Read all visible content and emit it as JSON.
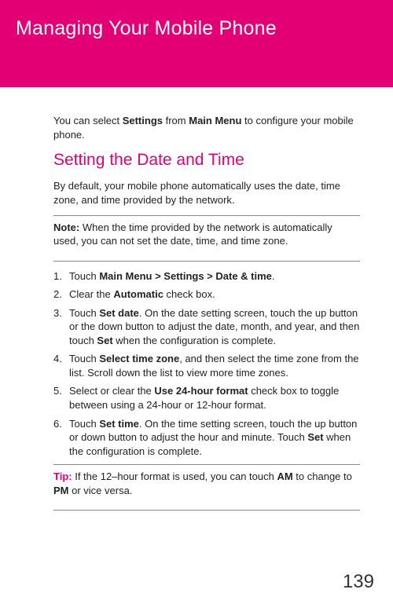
{
  "banner": {
    "title": "Managing Your Mobile Phone"
  },
  "intro": {
    "pre": "You can select ",
    "b1": "Settings",
    "mid": " from ",
    "b2": "Main Menu",
    "post": " to configure your mobile phone."
  },
  "section": {
    "heading": "Setting the Date and Time"
  },
  "default_text": "By default, your mobile phone automatically uses the date, time zone, and time provided by the network.",
  "note": {
    "label": "Note:  ",
    "text": "When the time provided by the network is automatically used, you can not set the date, time, and time zone."
  },
  "steps": {
    "s1": {
      "pre": "Touch ",
      "b": "Main Menu > Settings > Date & time",
      "post": "."
    },
    "s2": {
      "pre": "Clear the ",
      "b": "Automatic",
      "post": " check box."
    },
    "s3": {
      "pre": "Touch ",
      "b1": "Set date",
      "mid": ". On the date setting screen, touch the up button or the down button to adjust the date, month, and year, and then touch ",
      "b2": "Set",
      "post": " when the configuration is complete."
    },
    "s4": {
      "pre": "Touch ",
      "b": "Select time zone",
      "post": ", and then select the time zone from the list. Scroll down the list to view more time zones."
    },
    "s5": {
      "pre": "Select or clear the ",
      "b": "Use 24-hour format",
      "post": " check box to toggle between using a 24-hour or 12-hour format."
    },
    "s6": {
      "pre": "Touch ",
      "b1": "Set time",
      "mid": ". On the time setting screen, touch the up button or down button to adjust the hour and minute. Touch ",
      "b2": "Set",
      "post": " when the configuration is complete."
    }
  },
  "tip": {
    "label": "Tip:  ",
    "pre": "If the 12–hour format is used, you can touch ",
    "b1": "AM",
    "mid": " to change to ",
    "b2": "PM",
    "post": " or vice versa."
  },
  "page_number": "139"
}
